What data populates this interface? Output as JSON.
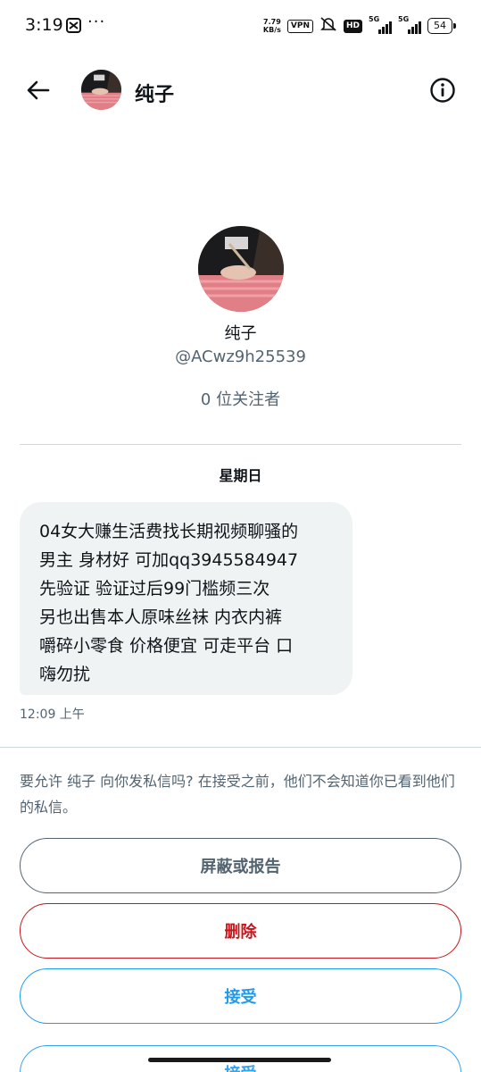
{
  "status_bar": {
    "time": "3:19",
    "dots": "···",
    "net_speed_value": "7.79",
    "net_speed_unit": "KB/s",
    "vpn": "VPN",
    "hd": "HD",
    "signal1_label": "5G",
    "signal2_label": "5G",
    "battery": "54"
  },
  "header": {
    "name": "纯子",
    "back_icon": "arrow-left-icon",
    "info_icon": "info-icon"
  },
  "profile": {
    "name": "纯子",
    "handle": "@ACwz9h25539",
    "followers": "0 位关注者"
  },
  "conversation": {
    "date_label": "星期日",
    "message_text": "04女大赚生活费找长期视频聊骚的\n男主  身材好 可加qq3945584947\n先验证  验证过后99门槛频三次\n另也出售本人原味丝袜 内衣内裤\n嚼碎小零食 价格便宜 可走平台  口\n嗨勿扰",
    "message_time": "12:09 上午"
  },
  "request": {
    "prompt": "要允许 纯子 向你发私信吗? 在接受之前，他们不会知道你已看到他们的私信。",
    "block_label": "屏蔽或报告",
    "delete_label": "删除",
    "accept_label": "接受",
    "ghost_label": "接受"
  },
  "colors": {
    "accent": "#1d9bf0",
    "danger": "#c4161c",
    "secondary_text": "#536471",
    "bubble_bg": "#eff3f4"
  }
}
